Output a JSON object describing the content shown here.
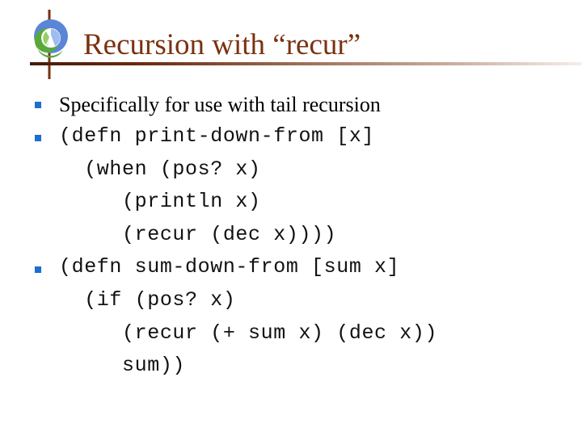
{
  "slide": {
    "title": "Recursion with “recur”",
    "logo_icon": "clojure-logo-icon",
    "colors": {
      "title": "#7a3210",
      "bullet": "#1a6fd0",
      "rule_start": "#4a1a08",
      "rule_end": "#f5eeea"
    },
    "bullets": [
      {
        "lines": [
          "Specifically for use with tail recursion"
        ]
      },
      {
        "lines": [
          "(defn print-down-from [x]",
          "  (when (pos? x)",
          "     (println x)",
          "     (recur (dec x))))"
        ]
      },
      {
        "lines": [
          "(defn sum-down-from [sum x]",
          "  (if (pos? x)",
          "     (recur (+ sum x) (dec x))",
          "     sum))"
        ]
      }
    ]
  }
}
